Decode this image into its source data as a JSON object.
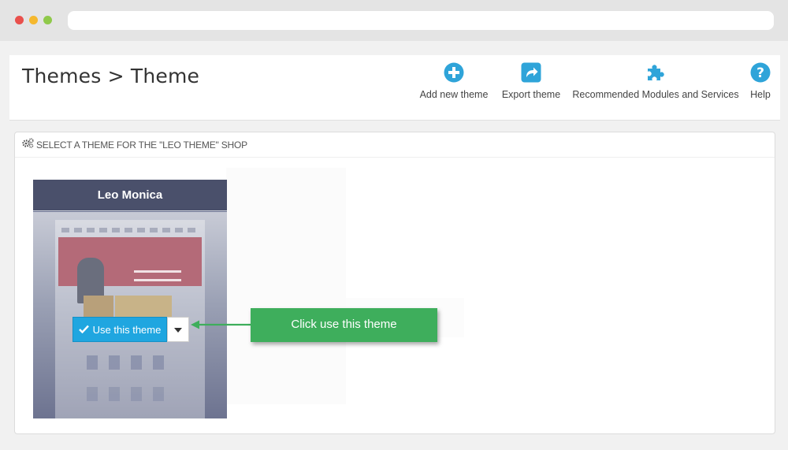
{
  "header": {
    "title": "Themes > Theme",
    "toolbar": {
      "add_new_theme": "Add new theme",
      "export_theme": "Export theme",
      "recommended": "Recommended Modules and Services",
      "help": "Help"
    }
  },
  "panel": {
    "heading": "SELECT A THEME FOR THE \"LEO THEME\" SHOP",
    "heading_icon": "gears-icon"
  },
  "theme_card": {
    "name": "Leo Monica",
    "use_button": "Use this theme",
    "use_icon": "check-icon",
    "dropdown_icon": "caret-down-icon"
  },
  "annotation": {
    "callout_text": "Click use this theme"
  },
  "colors": {
    "accent": "#2fa4d9",
    "use_button": "#1fa6e0",
    "callout": "#3eae5c",
    "card_header": "#4a506b"
  }
}
